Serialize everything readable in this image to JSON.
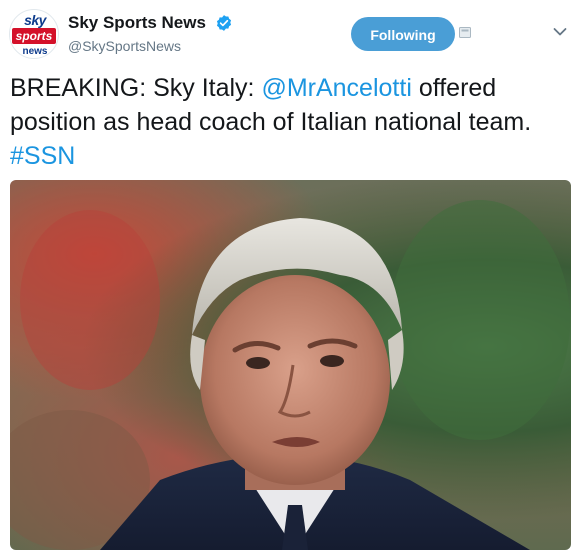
{
  "header": {
    "account_name": "Sky Sports News",
    "handle": "@SkySportsNews",
    "follow_label": "Following",
    "avatar_logo": {
      "line1": "sky",
      "line2": "sports",
      "line3": "news"
    },
    "verified_icon": "verified-badge-icon",
    "menu_icon": "chevron-down-icon"
  },
  "tweet": {
    "text_prefix": "BREAKING: Sky Italy: ",
    "mention": "@MrAncelotti",
    "text_middle": " offered position as head coach of Italian national team. ",
    "hashtag": "#SSN"
  },
  "colors": {
    "link": "#1b95e0",
    "follow_button": "#4a9ed6",
    "text": "#14171a",
    "secondary_text": "#657786"
  }
}
